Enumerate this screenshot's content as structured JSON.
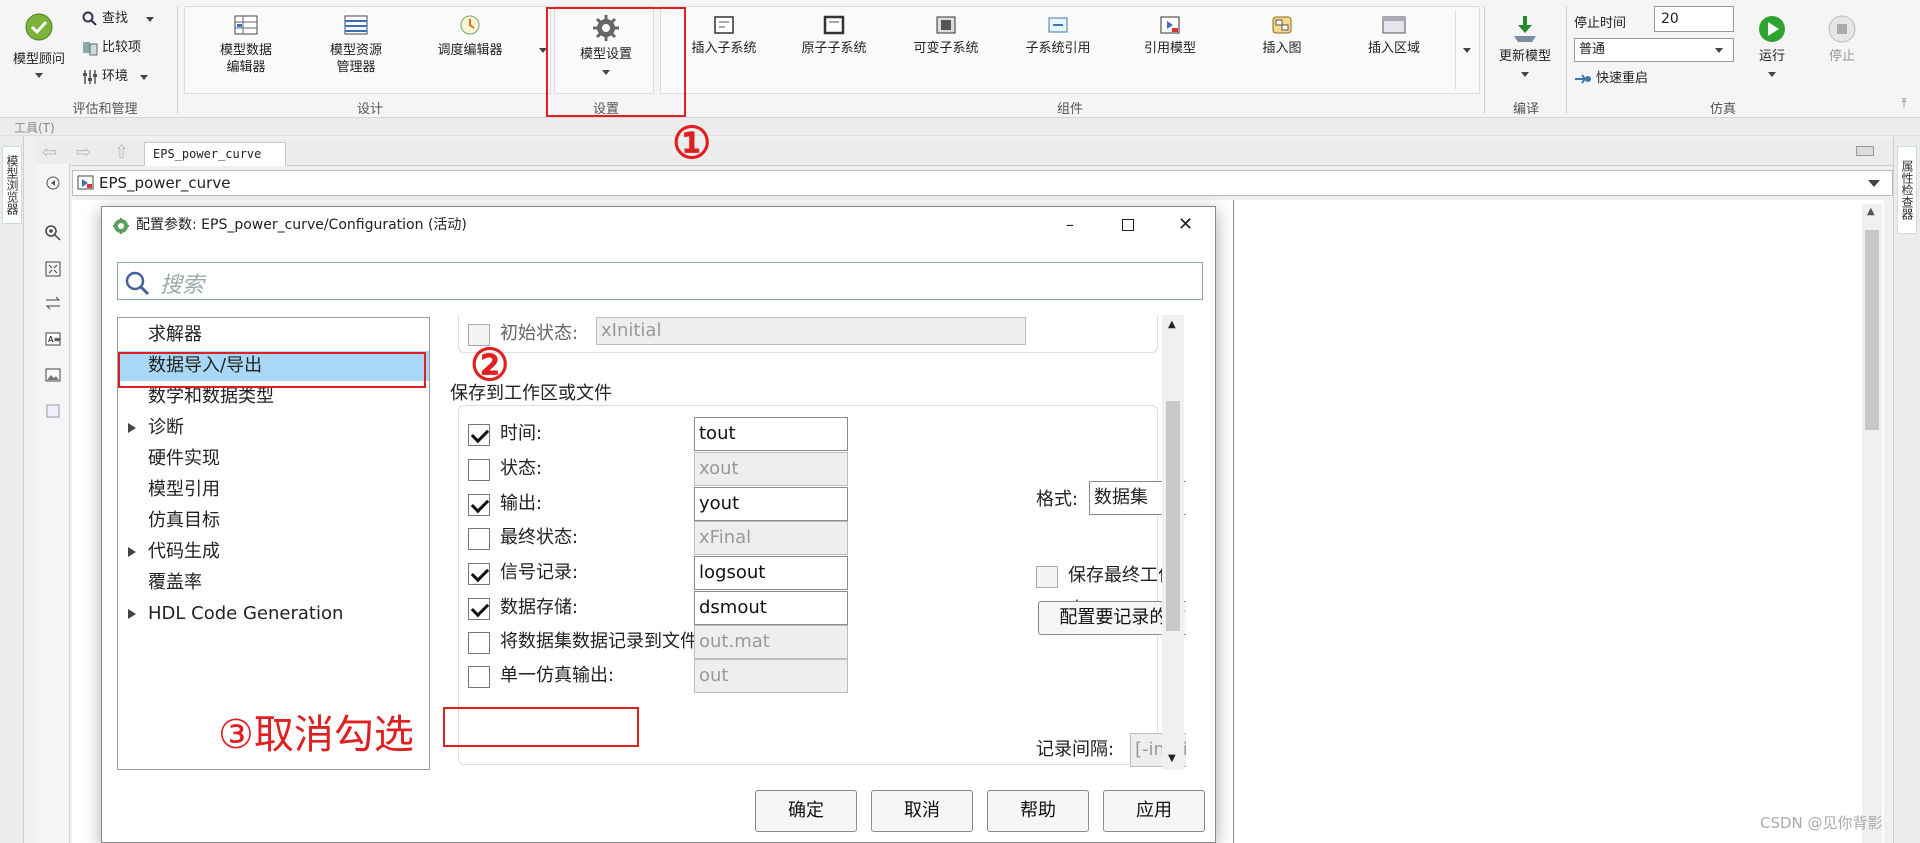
{
  "ribbon": {
    "group_eval": {
      "label": "评估和管理",
      "advisor": "模型顾问",
      "find": "查找",
      "compare": "比较项",
      "env": "环境"
    },
    "group_design": {
      "label": "设计",
      "items": [
        "模型数据\n编辑器",
        "模型资源\n管理器",
        "调度编辑器"
      ]
    },
    "group_setup": {
      "label": "设置",
      "model_settings": "模型设置"
    },
    "group_component": {
      "label": "组件",
      "items": [
        "插入子系统",
        "原子子系统",
        "可变子系统",
        "子系统引用",
        "引用模型",
        "插入图",
        "插入区域"
      ]
    },
    "group_compile": {
      "label": "编译",
      "update": "更新模型"
    },
    "group_sim": {
      "label": "仿真",
      "stop_time_label": "停止时间",
      "stop_time_value": "20",
      "mode": "普通",
      "fast_restart": "快速重启",
      "run": "运行",
      "stop": "停止"
    }
  },
  "toolbar_row": {
    "label": "工具(T)"
  },
  "left_strip": {
    "model_browser": "模型浏览器"
  },
  "right_strip": {
    "property_inspector": "属性检查器"
  },
  "tab": {
    "label": "EPS_power_curve"
  },
  "address": {
    "label": "EPS_power_curve"
  },
  "dialog": {
    "title": "配置参数: EPS_power_curve/Configuration (活动)",
    "search_placeholder": "搜索",
    "tree": [
      {
        "label": "求解器",
        "expandable": false,
        "selected": false
      },
      {
        "label": "数据导入/导出",
        "expandable": false,
        "selected": true
      },
      {
        "label": "数学和数据类型",
        "expandable": false,
        "selected": false
      },
      {
        "label": "诊断",
        "expandable": true,
        "selected": false
      },
      {
        "label": "硬件实现",
        "expandable": false,
        "selected": false
      },
      {
        "label": "模型引用",
        "expandable": false,
        "selected": false
      },
      {
        "label": "仿真目标",
        "expandable": false,
        "selected": false
      },
      {
        "label": "代码生成",
        "expandable": true,
        "selected": false
      },
      {
        "label": "覆盖率",
        "expandable": false,
        "selected": false
      },
      {
        "label": "HDL Code Generation",
        "expandable": true,
        "selected": false
      }
    ],
    "initial_state": {
      "label": "初始状态:",
      "value": "xInitial"
    },
    "section_title": "保存到工作区或文件",
    "rows": [
      {
        "label": "时间:",
        "value": "tout",
        "checked": true
      },
      {
        "label": "状态:",
        "value": "xout",
        "checked": false
      },
      {
        "label": "输出:",
        "value": "yout",
        "checked": true
      },
      {
        "label": "最终状态:",
        "value": "xFinal",
        "checked": false
      },
      {
        "label": "信号记录:",
        "value": "logsout",
        "checked": true
      },
      {
        "label": "数据存储:",
        "value": "dsmout",
        "checked": true
      },
      {
        "label": "将数据集数据记录到文件:",
        "value": "out.mat",
        "checked": false
      },
      {
        "label": "单一仿真输出:",
        "value": "out",
        "checked": false
      }
    ],
    "format_label": "格式:",
    "format_value": "数据集",
    "save_final_op": "保存最终工作点",
    "config_signals_btn": "配置要记录的信号...",
    "log_interval_label": "记录间隔:",
    "log_interval_value": "[-inf, inf]",
    "buttons": {
      "ok": "确定",
      "cancel": "取消",
      "help": "帮助",
      "apply": "应用"
    }
  },
  "annotations": {
    "one": "①",
    "two": "②",
    "three": "③取消勾选",
    "accent": "#e02020"
  },
  "watermark": "CSDN @见你背影"
}
